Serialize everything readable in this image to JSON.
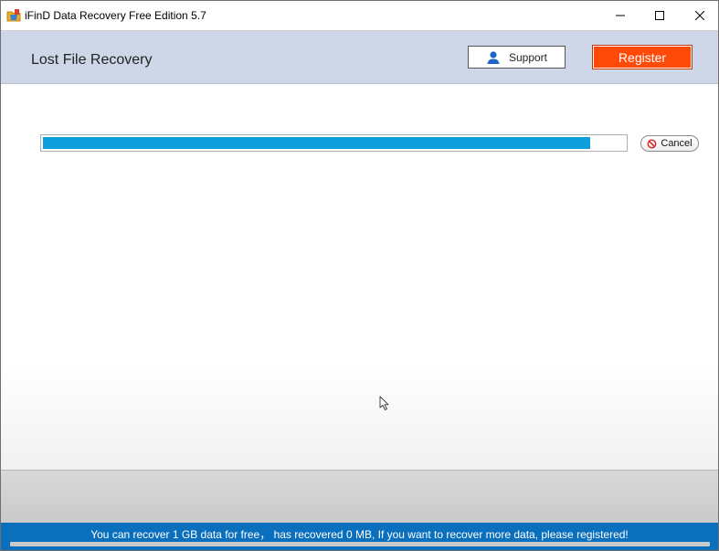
{
  "window": {
    "title": "iFinD Data Recovery Free Edition 5.7",
    "app_icon": "folder-shield-icon",
    "controls": [
      "minimize-icon",
      "maximize-icon",
      "close-icon"
    ]
  },
  "header": {
    "title": "Lost File Recovery",
    "support_label": "Support",
    "support_icon": "user-icon",
    "register_label": "Register"
  },
  "scan": {
    "progress_fraction": 0.94,
    "cancel_label": "Cancel",
    "cancel_icon": "prohibited-icon"
  },
  "status": {
    "message": "You can recover 1 GB data for free， has recovered 0 MB, If you want to recover more data, please registered!"
  },
  "colors": {
    "header_bg": "#ced7e8",
    "register_bg": "#ff4a0a",
    "progress_fill": "#0d9fdb",
    "status_bg": "#0a6fbd"
  }
}
